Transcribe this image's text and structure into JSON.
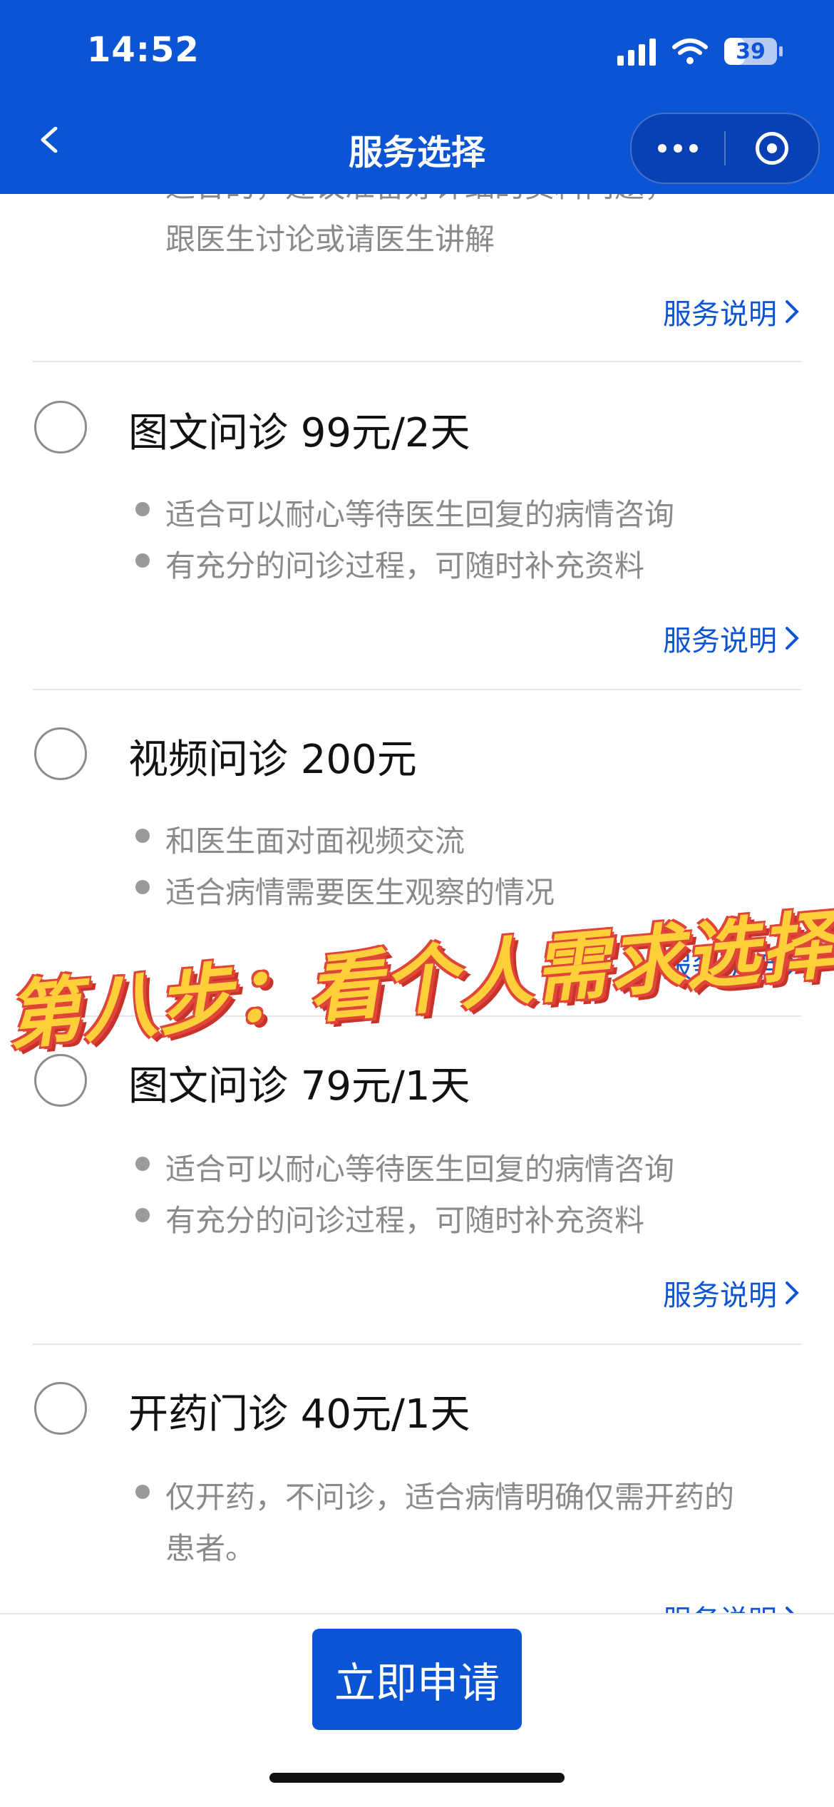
{
  "status_bar": {
    "time": "14:52",
    "battery": "39",
    "battery_fraction": 0.39
  },
  "nav": {
    "title": "服务选择"
  },
  "top_partial": {
    "cut_line": "适合的，建议准备好详细的资料问题，",
    "line2": "跟医生讨论或请医生讲解",
    "link": "服务说明"
  },
  "options": [
    {
      "title": "图文问诊 99元/2天",
      "bullets": [
        "适合可以耐心等待医生回复的病情咨询",
        "有充分的问诊过程，可随时补充资料"
      ],
      "link": "服务说明"
    },
    {
      "title": "视频问诊 200元",
      "bullets": [
        "和医生面对面视频交流",
        "适合病情需要医生观察的情况"
      ],
      "link": "服务说明"
    },
    {
      "title": "图文问诊 79元/1天",
      "bullets": [
        "适合可以耐心等待医生回复的病情咨询",
        "有充分的问诊过程，可随时补充资料"
      ],
      "link": "服务说明"
    },
    {
      "title": "开药门诊 40元/1天",
      "bullets": [
        "仅开药，不问诊，适合病情明确仅需开药的",
        "患者。"
      ],
      "link": "服务说明"
    }
  ],
  "overlay": {
    "text": "第八步：看个人需求选择"
  },
  "footer": {
    "apply_label": "立即申请"
  },
  "colors": {
    "brand": "#0b55d4",
    "overlay_fill": "#ffcf3a",
    "overlay_stroke": "#e0453a"
  }
}
